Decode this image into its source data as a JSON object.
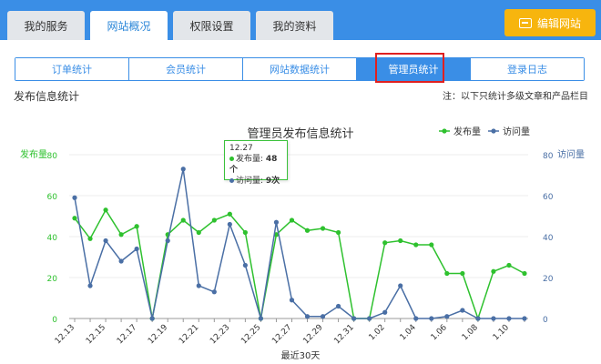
{
  "top_tabs": [
    {
      "label": "我的服务",
      "active": false
    },
    {
      "label": "网站概况",
      "active": true
    },
    {
      "label": "权限设置",
      "active": false
    },
    {
      "label": "我的资料",
      "active": false
    }
  ],
  "edit_button": {
    "label": "编辑网站"
  },
  "sub_tabs": [
    {
      "label": "订单统计",
      "active": false
    },
    {
      "label": "会员统计",
      "active": false
    },
    {
      "label": "网站数据统计",
      "active": false
    },
    {
      "label": "管理员统计",
      "active": true
    },
    {
      "label": "登录日志",
      "active": false
    }
  ],
  "section_title": "发布信息统计",
  "note": "注：以下只统计多级文章和产品栏目",
  "tooltip": {
    "date": "12.27",
    "publish_label": "发布量",
    "publish_value": "48个",
    "visit_label": "访问量",
    "visit_value": "9次"
  },
  "chart_data": {
    "type": "line",
    "title": "管理员发布信息统计",
    "xlabel": "最近30天",
    "ylabel_left": "发布量",
    "ylabel_right": "访问量",
    "ylim_left": [
      0,
      80
    ],
    "ylim_right": [
      0,
      80
    ],
    "yticks_left": [
      0,
      20,
      40,
      60,
      80
    ],
    "yticks_right": [
      0,
      20,
      40,
      60,
      80
    ],
    "legend_position": "top-right",
    "categories": [
      "12.13",
      "12.14",
      "12.15",
      "12.16",
      "12.17",
      "12.18",
      "12.19",
      "12.20",
      "12.21",
      "12.22",
      "12.23",
      "12.24",
      "12.25",
      "12.26",
      "12.27",
      "12.28",
      "12.29",
      "12.30",
      "12.31",
      "1.01",
      "1.02",
      "1.03",
      "1.04",
      "1.05",
      "1.06",
      "1.07",
      "1.08",
      "1.09",
      "1.10",
      "1.11"
    ],
    "tick_labels": [
      "12.13",
      "12.15",
      "12.17",
      "12.19",
      "12.21",
      "12.23",
      "12.25",
      "12.27",
      "12.29",
      "12.31",
      "1.02",
      "1.04",
      "1.06",
      "1.08",
      "1.10"
    ],
    "series": [
      {
        "name": "发布量",
        "color": "#2ec12e",
        "axis": "left",
        "values": [
          49,
          39,
          53,
          41,
          45,
          0,
          41,
          48,
          42,
          48,
          51,
          42,
          0,
          41,
          48,
          43,
          44,
          42,
          0,
          0,
          37,
          38,
          36,
          36,
          22,
          22,
          0,
          23,
          26,
          22
        ]
      },
      {
        "name": "访问量",
        "color": "#4a6fa5",
        "axis": "right",
        "values": [
          59,
          16,
          38,
          28,
          34,
          0,
          38,
          73,
          16,
          13,
          46,
          26,
          0,
          47,
          9,
          1,
          1,
          6,
          0,
          0,
          3,
          16,
          0,
          0,
          1,
          4,
          0,
          0,
          0,
          0
        ]
      }
    ]
  }
}
